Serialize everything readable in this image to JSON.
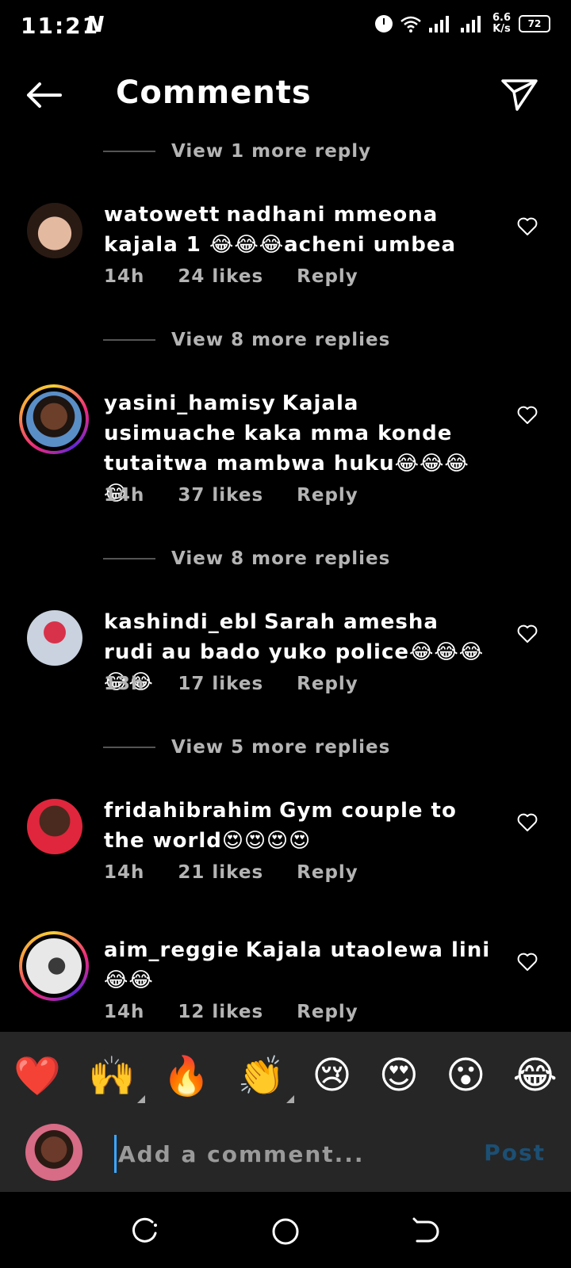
{
  "status": {
    "time": "11:21",
    "carrier_mark": "N",
    "speed_value": "6.6",
    "speed_unit": "K/s",
    "battery": "72"
  },
  "header": {
    "title": "Comments"
  },
  "view_replies": [
    "View 1 more reply",
    "View 8 more replies",
    "View 8 more replies",
    "View 5 more replies"
  ],
  "comments": [
    {
      "username": "watowett",
      "text": "nadhani mmeona kajala 1 😂😂😂acheni umbea",
      "time": "14h",
      "likes": "24 likes",
      "reply": "Reply",
      "story_ring": false
    },
    {
      "username": "yasini_hamisy",
      "text": "Kajala usimuache kaka mma konde tutaitwa mambwa huku😂😂😂😂",
      "time": "14h",
      "likes": "37 likes",
      "reply": "Reply",
      "story_ring": true
    },
    {
      "username": "kashindi_ebl",
      "text": "Sarah amesha rudi au bado yuko police😂😂😂😂😂",
      "time": "13h",
      "likes": "17 likes",
      "reply": "Reply",
      "story_ring": false
    },
    {
      "username": "fridahibrahim",
      "text": "Gym couple to the world😍😍😍😍",
      "time": "14h",
      "likes": "21 likes",
      "reply": "Reply",
      "story_ring": false
    },
    {
      "username": "aim_reggie",
      "text": "Kajala utaolewa lini😂😂",
      "time": "14h",
      "likes": "12 likes",
      "reply": "Reply",
      "story_ring": true
    }
  ],
  "emoji_bar": [
    "❤️",
    "🙌",
    "🔥",
    "👏",
    "😢",
    "😍",
    "😮",
    "😂"
  ],
  "composer": {
    "placeholder": "Add a comment...",
    "post_label": "Post"
  },
  "colors": {
    "background": "#000000",
    "muted_text": "#b4b4b4",
    "bar_background": "#262626",
    "post_disabled": "#1c4f74"
  }
}
